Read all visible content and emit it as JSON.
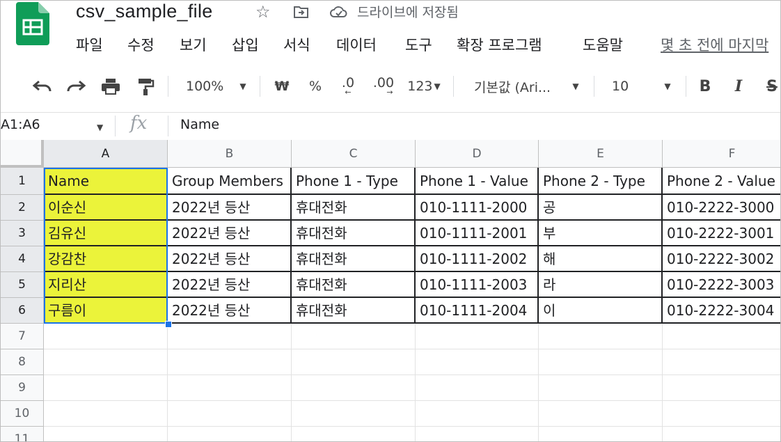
{
  "app": {
    "doc_title": "csv_sample_file",
    "save_status": "드라이브에 저장됨",
    "last_edit": "몇 초 전에 마지막",
    "brand_color": "#0f9d58"
  },
  "menu": [
    "파일",
    "수정",
    "보기",
    "삽입",
    "서식",
    "데이터",
    "도구",
    "확장 프로그램",
    "도움말"
  ],
  "toolbar": {
    "zoom": "100%",
    "currency": "₩",
    "percent": "%",
    "decrease_decimal": ".0",
    "increase_decimal": ".00",
    "more_formats": "123",
    "font": "기본값 (Ari...",
    "font_size": "10",
    "bold": "B",
    "italic": "I",
    "strike": "S",
    "icons": [
      "undo-icon",
      "redo-icon",
      "print-icon",
      "paint-format-icon"
    ]
  },
  "formula_bar": {
    "name_box": "A1:A6",
    "fx": "fx",
    "content": "Name"
  },
  "grid": {
    "columns": [
      "A",
      "B",
      "C",
      "D",
      "E",
      "F"
    ],
    "row_numbers": [
      "1",
      "2",
      "3",
      "4",
      "5",
      "6",
      "7",
      "8",
      "9",
      "10",
      "11"
    ],
    "header": [
      "Name",
      "Group Members",
      "Phone 1 - Type",
      "Phone 1 - Value",
      "Phone 2 - Type",
      "Phone 2 - Value"
    ],
    "rows": [
      [
        "이순신",
        "2022년 등산",
        "휴대전화",
        "010-1111-2000",
        "공",
        "010-2222-3000"
      ],
      [
        "김유신",
        "2022년 등산",
        "휴대전화",
        "010-1111-2001",
        "부",
        "010-2222-3001"
      ],
      [
        "강감찬",
        "2022년 등산",
        "휴대전화",
        "010-1111-2002",
        "해",
        "010-2222-3002"
      ],
      [
        "지리산",
        "2022년 등산",
        "휴대전화",
        "010-1111-2003",
        "라",
        "010-2222-3003"
      ],
      [
        "구름이",
        "2022년 등산",
        "휴대전화",
        "010-1111-2004",
        "이",
        "010-2222-3004"
      ]
    ],
    "highlight_color": "#ebf33a",
    "selection_color": "#1a73e8"
  }
}
